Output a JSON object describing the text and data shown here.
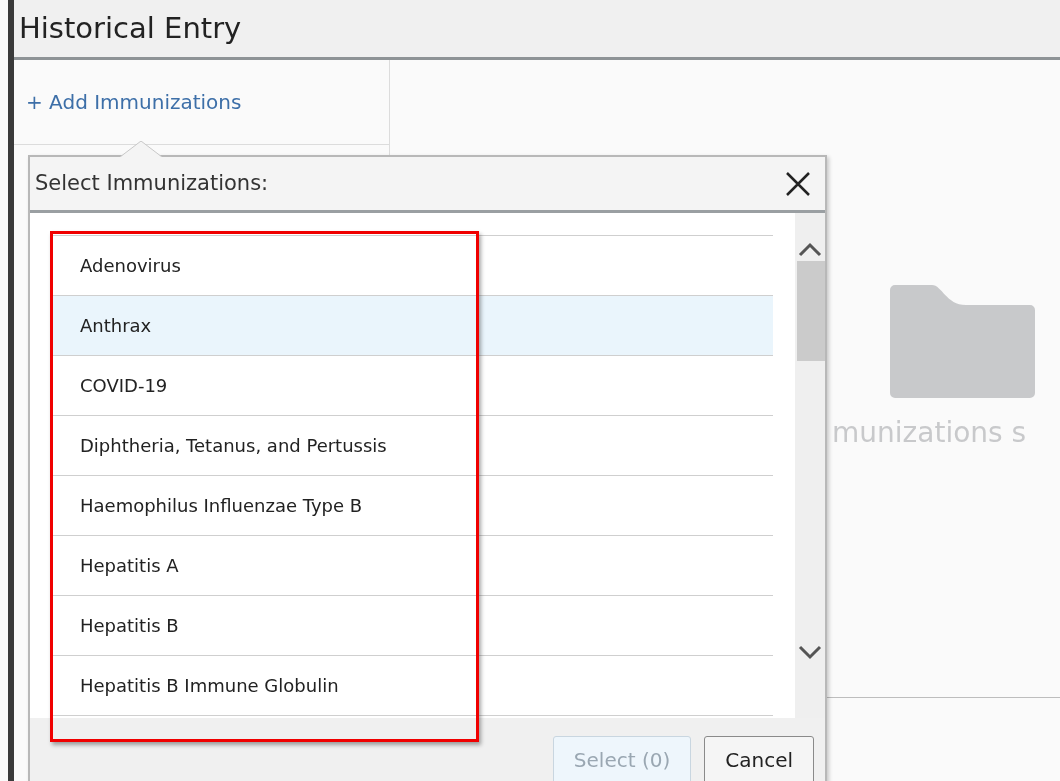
{
  "header": {
    "title": "Historical Entry"
  },
  "add_link": {
    "icon": "+",
    "label": "Add Immunizations"
  },
  "empty_state": {
    "text": "munizations s"
  },
  "popup": {
    "title": "Select Immunizations:",
    "items": [
      {
        "label": "Adenovirus",
        "selected": false
      },
      {
        "label": "Anthrax",
        "selected": true
      },
      {
        "label": "COVID-19",
        "selected": false
      },
      {
        "label": "Diphtheria, Tetanus, and Pertussis",
        "selected": false
      },
      {
        "label": "Haemophilus Influenzae Type B",
        "selected": false
      },
      {
        "label": "Hepatitis A",
        "selected": false
      },
      {
        "label": "Hepatitis B",
        "selected": false
      },
      {
        "label": "Hepatitis B Immune Globulin",
        "selected": false
      }
    ],
    "buttons": [
      {
        "label": "Select (0)",
        "disabled": true
      },
      {
        "label": "Cancel",
        "disabled": false
      }
    ]
  }
}
